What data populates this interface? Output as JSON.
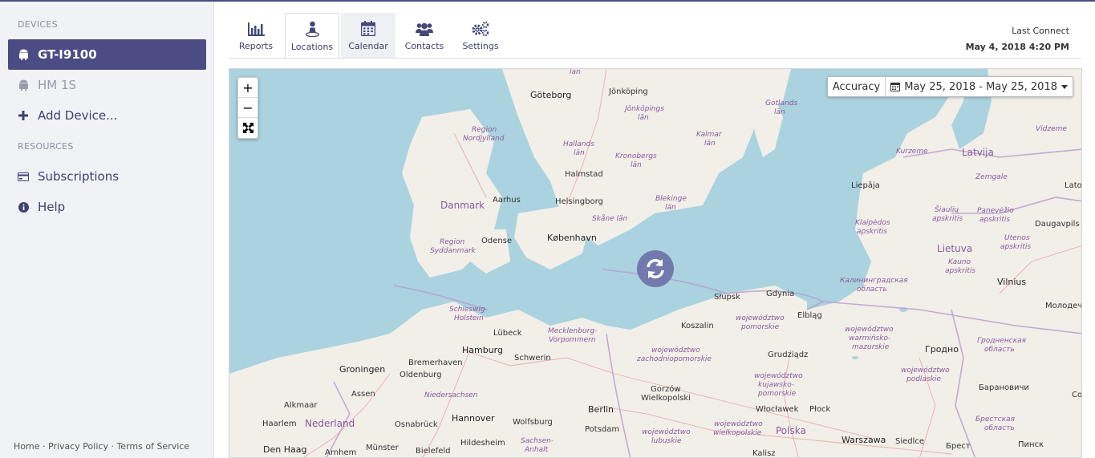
{
  "sidebar": {
    "devices_heading": "DEVICES",
    "resources_heading": "RESOURCES",
    "devices": [
      {
        "label": "GT-I9100",
        "icon": "android-icon",
        "active": true
      },
      {
        "label": "HM 1S",
        "icon": "android-icon",
        "active": false
      }
    ],
    "add_device": "Add Device...",
    "resources": [
      {
        "label": "Subscriptions",
        "icon": "credit-card-icon"
      },
      {
        "label": "Help",
        "icon": "info-icon"
      }
    ],
    "footer": {
      "home": "Home",
      "sep": "·",
      "privacy": "Privacy Policy",
      "terms": "Terms of Service"
    }
  },
  "tabs": [
    {
      "label": "Reports",
      "icon": "bar-chart-icon"
    },
    {
      "label": "Locations",
      "icon": "map-pin-user-icon"
    },
    {
      "label": "Calendar",
      "icon": "calendar-icon"
    },
    {
      "label": "Contacts",
      "icon": "users-icon"
    },
    {
      "label": "Settings",
      "icon": "gears-icon"
    }
  ],
  "last_connect": {
    "label": "Last Connect",
    "date": "May 4, 2018 4:20 PM"
  },
  "map": {
    "zoom_in": "+",
    "zoom_out": "−",
    "accuracy_label": "Accuracy",
    "date_range": "May 25, 2018 - May 25, 2018",
    "labels": {
      "l1": "län",
      "l2": "Göteborg",
      "l3": "Jönköping",
      "l4": "Jönköpings",
      "l5": "län",
      "l6": "Gotlands",
      "l7": "län",
      "l8": "Region",
      "l9": "Nordjylland",
      "l10": "Hallands",
      "l11": "län",
      "l12": "Kalmar",
      "l13": "län",
      "l14": "Kronobergs",
      "l15": "län",
      "l16": "Halmstad",
      "l17": "Danmark",
      "l18": "Aarhus",
      "l19": "Helsingborg",
      "l20": "Blekinge",
      "l21": "län",
      "l22": "Skåne län",
      "l23": "København",
      "l24": "Region",
      "l25": "Syddanmark",
      "l26": "Odense",
      "l27": "Vidzeme",
      "l28": "Kurzeme",
      "l29": "Latvija",
      "l30": "Zemgale",
      "l31": "Liepāja",
      "l32": "Šiaulių",
      "l33": "apskritis",
      "l34": "Panevėžio",
      "l35": "apskritis",
      "l36": "Klaipėdos",
      "l37": "apskritis",
      "l38": "Daugavpils",
      "l39": "Utenos",
      "l40": "apskritis",
      "l41": "Lietuva",
      "l42": "Kauno",
      "l43": "apskritis",
      "l44": "Vilnius",
      "l45": "Калининградская",
      "l46": "область",
      "l47": "Słupsk",
      "l48": "Gdynia",
      "l49": "Elbląg",
      "l50": "Schleswig-",
      "l51": "Holstein",
      "l52": "Lübeck",
      "l53": "Mecklenburg-",
      "l54": "Vorpommern",
      "l55": "Koszalin",
      "l56": "województwo",
      "l57": "pomorskie",
      "l58": "Hamburg",
      "l59": "Schwerin",
      "l60": "województwo",
      "l61": "zachodniopomorskie",
      "l62": "Grudziądz",
      "l63": "województwo",
      "l64": "warmińsko-",
      "l65": "mazurskie",
      "l66": "Гродно",
      "l67": "Гродненская",
      "l68": "область",
      "l69": "Bremerhaven",
      "l70": "Groningen",
      "l71": "Oldenburg",
      "l72": "Assen",
      "l73": "Niedersachsen",
      "l74": "Gorzów",
      "l75": "Wielkopolski",
      "l76": "województwo",
      "l77": "kujawsko-",
      "l78": "pomorskie",
      "l79": "województwo",
      "l80": "podlaskie",
      "l81": "Alkmaar",
      "l82": "Haarlem",
      "l83": "Nederland",
      "l84": "Osnabrück",
      "l85": "Hannover",
      "l86": "Wolfsburg",
      "l87": "Berlin",
      "l88": "Potsdam",
      "l89": "Włocławek",
      "l90": "Płock",
      "l91": "Барановичи",
      "l92": "Den Haag",
      "l93": "Arnhem",
      "l94": "Münster",
      "l95": "Bielefeld",
      "l96": "Hildesheim",
      "l97": "Sachsen-",
      "l98": "Anhalt",
      "l99": "województwo",
      "l100": "lubuskie",
      "l101": "województwo",
      "l102": "wielkopolskie",
      "l103": "Polska",
      "l104": "Warszawa",
      "l105": "Siedlce",
      "l106": "Брест",
      "l107": "Брестская",
      "l108": "область",
      "l109": "Пинск",
      "l110": "Молодеч",
      "l111": "Kalisz",
      "l112": "Lato",
      "l113": "Co"
    }
  },
  "colors": {
    "accent": "#4b4c84",
    "water": "#aad3df",
    "land": "#f2efe9",
    "border": "#b79ad0"
  }
}
